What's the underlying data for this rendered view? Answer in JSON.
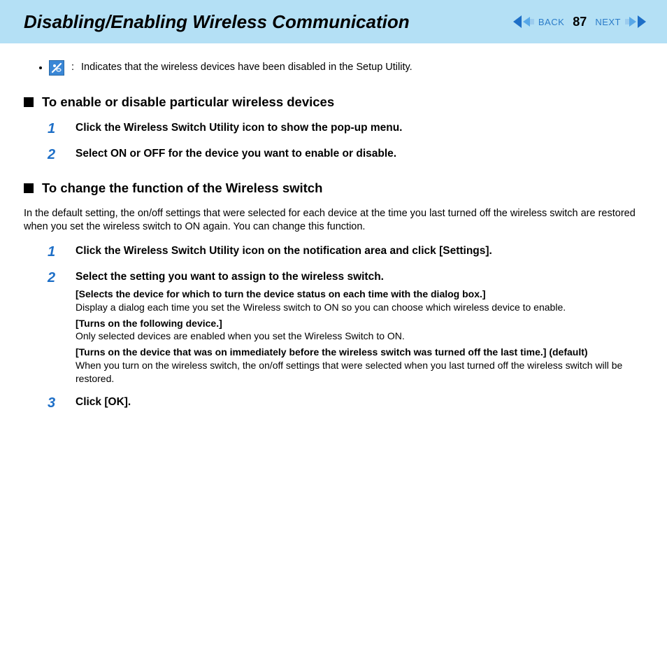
{
  "header": {
    "title": "Disabling/Enabling Wireless Communication",
    "back_label": "BACK",
    "next_label": "NEXT",
    "page_number": "87"
  },
  "bullet": {
    "colon": ":",
    "text": "Indicates that the wireless devices have been disabled in the Setup Utility."
  },
  "section1": {
    "title": "To enable or disable particular wireless devices",
    "steps": [
      {
        "num": "1",
        "title": "Click the Wireless Switch Utility icon to show the pop-up menu."
      },
      {
        "num": "2",
        "title": "Select ON or OFF for the device you want to enable or disable."
      }
    ]
  },
  "section2": {
    "title": "To change the function of the Wireless switch",
    "intro": "In the default setting, the on/off settings that were selected for each device at the time you last turned off the wireless switch are restored when you set the wireless switch to ON again. You can change this function.",
    "steps": {
      "s1": {
        "num": "1",
        "title": "Click the Wireless Switch Utility icon on the notification area and click [Settings]."
      },
      "s2": {
        "num": "2",
        "title": "Select the setting you want to assign to the wireless switch.",
        "opt1_bold": "[Selects the device for which to turn the device status on each time with the dialog box.]",
        "opt1_text": "Display a dialog each time you set the Wireless switch to ON so you can choose which wireless device to enable.",
        "opt2_bold": "[Turns on the following device.]",
        "opt2_text": "Only selected devices are enabled when you set the Wireless Switch to ON.",
        "opt3_bold": "[Turns on the device that was on immediately before the wireless switch was turned off the last time.] (default)",
        "opt3_text": "When you turn on the wireless switch, the on/off settings that were selected when you last turned off the wireless switch will be restored."
      },
      "s3": {
        "num": "3",
        "title": "Click [OK]."
      }
    }
  }
}
